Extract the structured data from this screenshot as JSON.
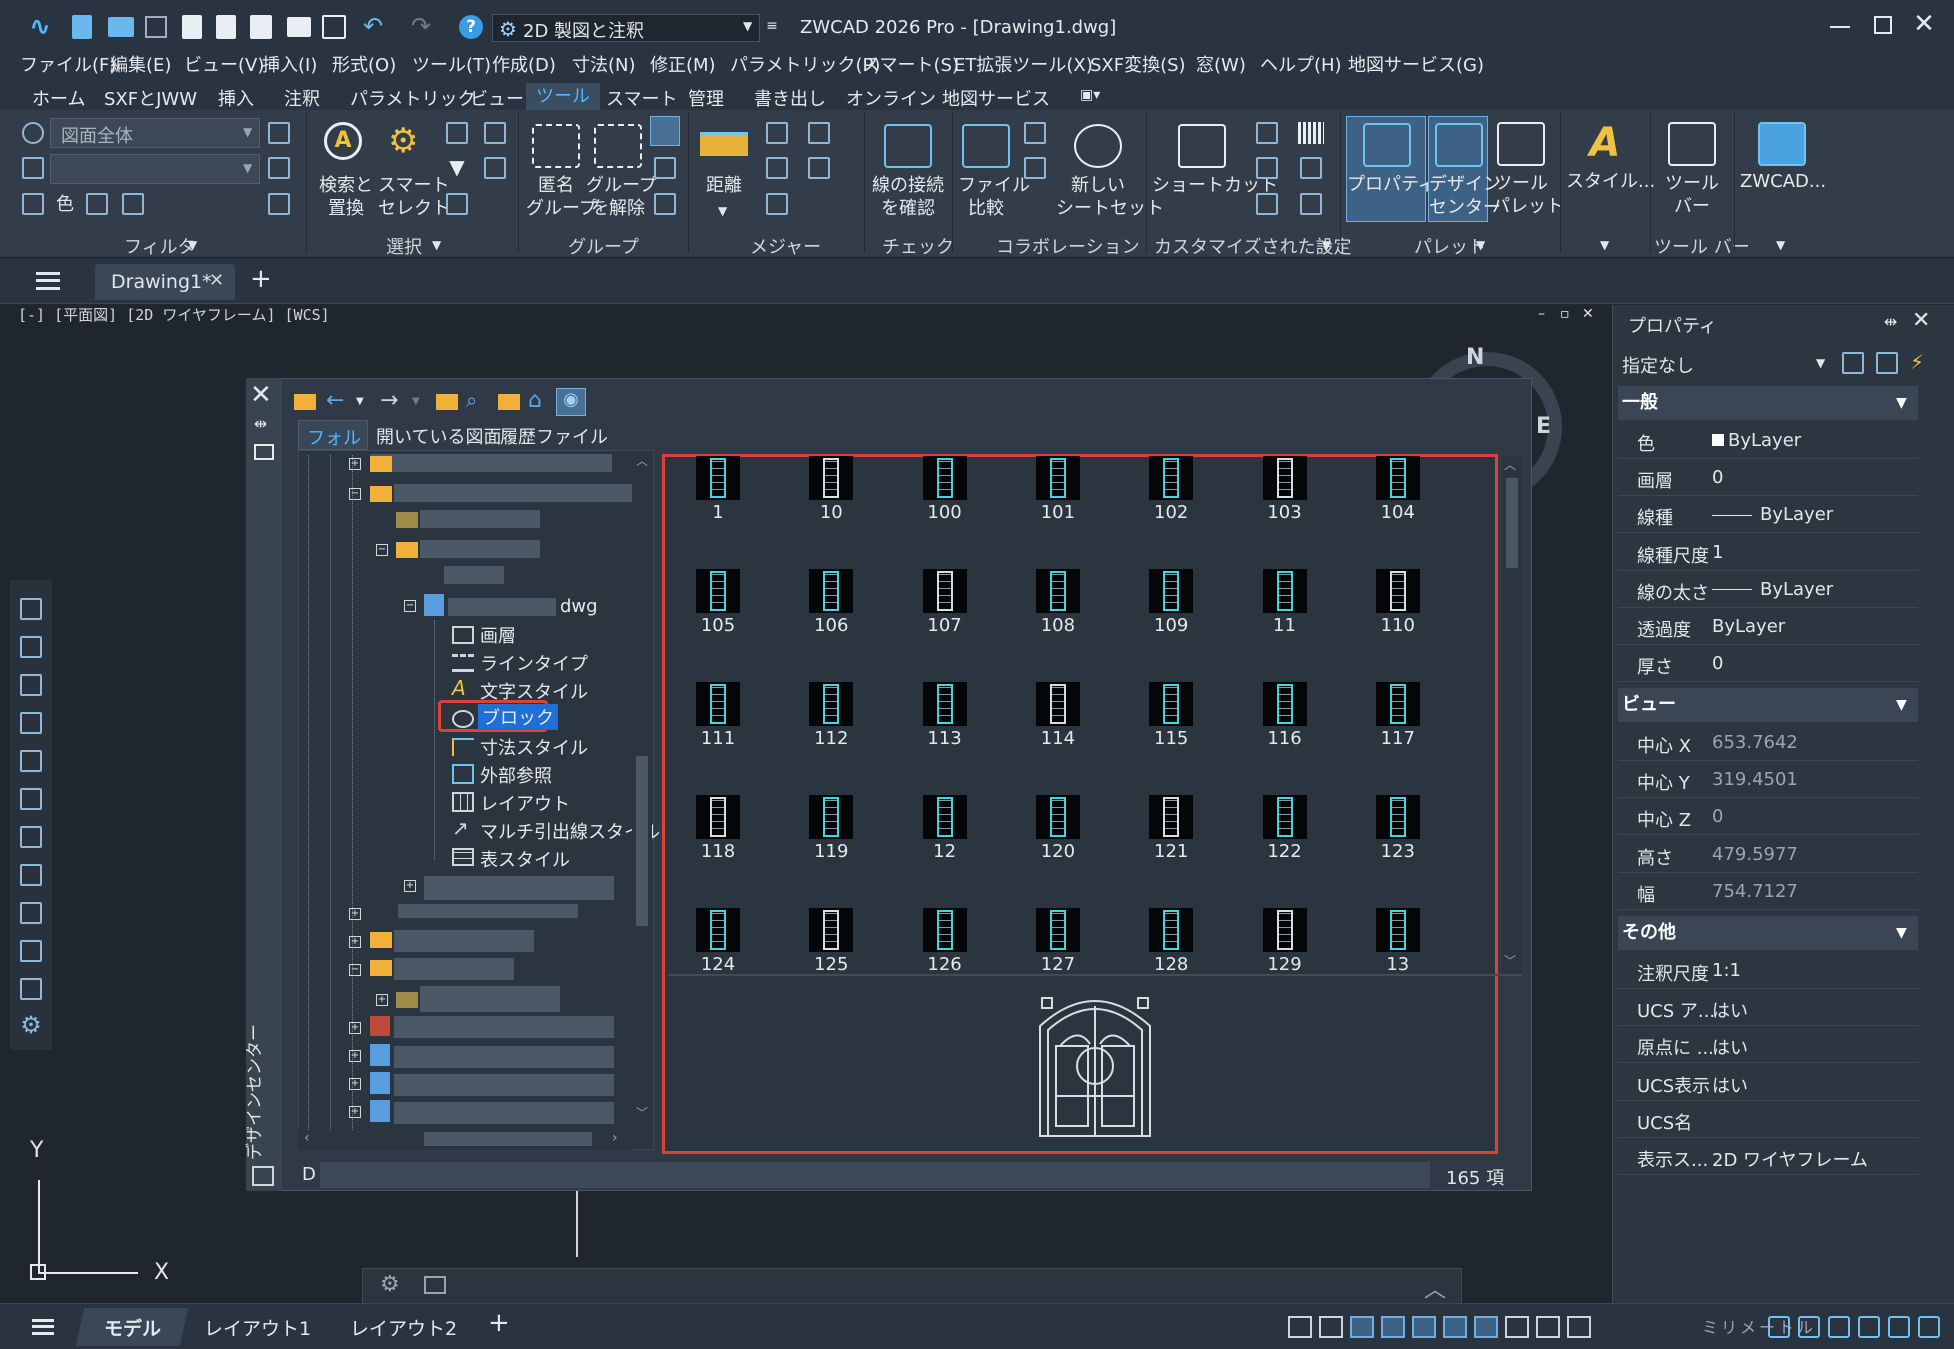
{
  "window": {
    "quickaccess_workspace": "2D 製図と注釈",
    "title": "ZWCAD 2026 Pro - [Drawing1.dwg]"
  },
  "menu": [
    "ファイル(F)",
    "編集(E)",
    "ビュー(V)",
    "挿入(I)",
    "形式(O)",
    "ツール(T)",
    "作成(D)",
    "寸法(N)",
    "修正(M)",
    "パラメトリック(P)",
    "スマート(S)",
    "ET拡張ツール(X)",
    "SXF変換(S)",
    "窓(W)",
    "ヘルプ(H)",
    "地図サービス(G)"
  ],
  "ribbon_tabs": [
    "ホーム",
    "SXFとJWW",
    "挿入",
    "注釈",
    "パラメトリック",
    "ビュー",
    "ツール",
    "スマート",
    "管理",
    "書き出し",
    "オンライン",
    "地図サービス"
  ],
  "ribbon_active_tab": "ツール",
  "ribbon": {
    "filter_combo": "図面全体",
    "groups": {
      "filter": "フィルタ",
      "select": "選択",
      "group": "グループ",
      "measure": "メジャー",
      "check": "チェック",
      "collab": "コラボレーション",
      "custom": "カスタマイズされた設定",
      "palette": "パレット",
      "toolbar": "ツール バー"
    },
    "buttons": {
      "find_l1": "検索と",
      "find_l2": "置換",
      "smart_l1": "スマート",
      "smart_l2": "セレクト",
      "anon_l1": "匿名",
      "anon_l2": "グループ",
      "ungroup_l1": "グループ",
      "ungroup_l2": "を解除",
      "dist": "距離",
      "conn_l1": "線の接続",
      "conn_l2": "を確認",
      "fcmp_l1": "ファイル",
      "fcmp_l2": "比較",
      "newsheet_l1": "新しい",
      "newsheet_l2": "シートセット",
      "shortcut": "ショートカット",
      "props": "プロパティ",
      "dc_l1": "デザイン",
      "dc_l2": "センター",
      "tp_l1": "ツール",
      "tp_l2": "パレット",
      "style": "スタイル...",
      "tb_l1": "ツール",
      "tb_l2": "バー",
      "zwcad": "ZWCAD..."
    }
  },
  "doc_tab": "Drawing1*",
  "viewport_label": "[-] [平面図] [2D ワイヤフレーム] [WCS]",
  "compass": {
    "n": "N",
    "e": "E"
  },
  "design_center": {
    "vertical_title": "デザインセンター",
    "tabs": [
      "フォルダ",
      "開いている図面",
      "履歴ファイル"
    ],
    "dwg_suffix": "dwg",
    "tree_items": [
      "画層",
      "ラインタイプ",
      "文字スタイル",
      "ブロック",
      "寸法スタイル",
      "外部参照",
      "レイアウト",
      "マルチ引出線スタイル",
      "表スタイル"
    ],
    "selected_item": "ブロック",
    "blocks": [
      "1",
      "10",
      "100",
      "101",
      "102",
      "103",
      "104",
      "105",
      "106",
      "107",
      "108",
      "109",
      "11",
      "110",
      "111",
      "112",
      "113",
      "114",
      "115",
      "116",
      "117",
      "118",
      "119",
      "12",
      "120",
      "121",
      "122",
      "123",
      "124",
      "125",
      "126",
      "127",
      "128",
      "129",
      "13"
    ],
    "path_prefix": "D",
    "count": "165 項"
  },
  "properties": {
    "title": "プロパティ",
    "selection": "指定なし",
    "sections": {
      "general": {
        "title": "一般",
        "rows": [
          [
            "色",
            "ByLayer"
          ],
          [
            "画層",
            "0"
          ],
          [
            "線種",
            "ByLayer"
          ],
          [
            "線種尺度",
            "1"
          ],
          [
            "線の太さ",
            "ByLayer"
          ],
          [
            "透過度",
            "ByLayer"
          ],
          [
            "厚さ",
            "0"
          ]
        ]
      },
      "view": {
        "title": "ビュー",
        "rows": [
          [
            "中心 X",
            "653.7642"
          ],
          [
            "中心 Y",
            "319.4501"
          ],
          [
            "中心 Z",
            "0"
          ],
          [
            "高さ",
            "479.5977"
          ],
          [
            "幅",
            "754.7127"
          ]
        ]
      },
      "misc": {
        "title": "その他",
        "rows": [
          [
            "注釈尺度",
            "1:1"
          ],
          [
            "UCS ア...",
            "はい"
          ],
          [
            "原点に ...",
            "はい"
          ],
          [
            "UCS表示",
            "はい"
          ],
          [
            "UCS名",
            ""
          ],
          [
            "表示ス...",
            "2D ワイヤフレーム"
          ]
        ]
      }
    }
  },
  "ucs": {
    "x": "X",
    "y": "Y"
  },
  "layout_tabs": [
    "モデル",
    "レイアウト1",
    "レイアウト2"
  ],
  "status": {
    "units": "ミリメートル"
  }
}
